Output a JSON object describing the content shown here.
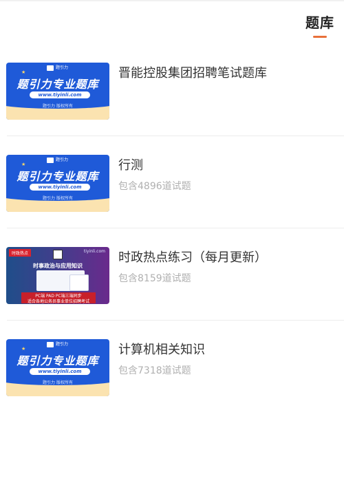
{
  "tabbar": {
    "active_tab": "题库"
  },
  "thumbnails": {
    "blue": {
      "logo_text": "题引力",
      "main_text": "题引力专业题库",
      "url": "www.tiyinli.com",
      "copyright": "题引力 版权所有"
    },
    "purple": {
      "tag": "时政热点",
      "site": "tiyinli.com",
      "headline": "时事政治与应用知识",
      "line1": "PC端   PAD  PC端三端同步",
      "line2": "适合各地公务员事业单位招聘考试"
    }
  },
  "items": [
    {
      "title": "晋能控股集团招聘笔试题库",
      "subtitle": "",
      "thumb": "blue"
    },
    {
      "title": "行测",
      "subtitle": "包含4896道试题",
      "thumb": "blue"
    },
    {
      "title": "时政热点练习（每月更新）",
      "subtitle": "包含8159道试题",
      "thumb": "purple"
    },
    {
      "title": "计算机相关知识",
      "subtitle": "包含7318道试题",
      "thumb": "blue"
    }
  ]
}
